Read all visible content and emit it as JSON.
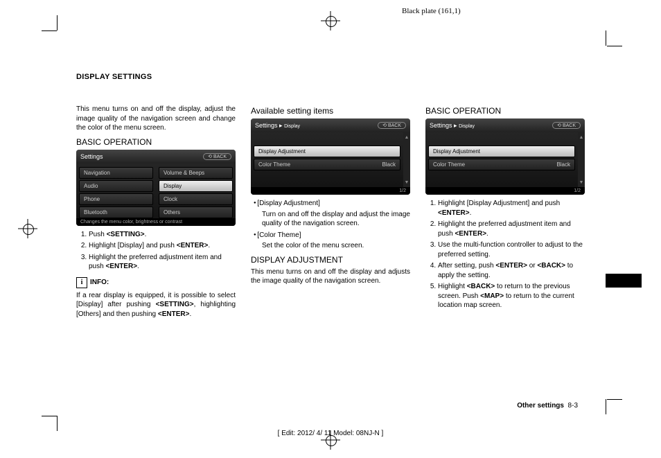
{
  "plate": "Black plate (161,1)",
  "heading": "DISPLAY SETTINGS",
  "col1": {
    "intro": "This menu turns on and off the display, adjust the image quality of the navigation screen and change the color of the menu screen.",
    "h_basic": "BASIC OPERATION",
    "screen": {
      "title": "Settings",
      "back": "BACK",
      "left": [
        "Navigation",
        "Audio",
        "Phone",
        "Bluetooth"
      ],
      "right": [
        "Volume & Beeps",
        "Display",
        "Clock",
        "Others"
      ],
      "footer": "Changes the menu color, brightness or contrast"
    },
    "steps": [
      "Push <SETTING>.",
      "Highlight [Display] and push <ENTER>.",
      "Highlight the preferred adjustment item and push <ENTER>."
    ],
    "info_label": "INFO:",
    "info_text": "If a rear display is equipped, it is possible to select [Display] after pushing <SETTING>, highlighting [Others] and then pushing <ENTER>."
  },
  "col2": {
    "h_avail": "Available setting items",
    "screen": {
      "title": "Settings",
      "crumb": "Display",
      "back": "BACK",
      "rows": [
        {
          "l": "Display Adjustment",
          "r": ""
        },
        {
          "l": "Color Theme",
          "r": "Black"
        }
      ],
      "page": "1/2"
    },
    "bullets": [
      {
        "head": "[Display Adjustment]",
        "body": "Turn on and off the display and adjust the image quality of the navigation screen."
      },
      {
        "head": "[Color Theme]",
        "body": "Set the color of the menu screen."
      }
    ],
    "h_adj": "DISPLAY ADJUSTMENT",
    "adj_text": "This menu turns on and off the display and adjusts the image quality of the navigation screen."
  },
  "col3": {
    "h_basic": "BASIC OPERATION",
    "screen": {
      "title": "Settings",
      "crumb": "Display",
      "back": "BACK",
      "rows": [
        {
          "l": "Display Adjustment",
          "r": ""
        },
        {
          "l": "Color Theme",
          "r": "Black"
        }
      ],
      "page": "1/2"
    },
    "steps": [
      "Highlight [Display Adjustment] and push <ENTER>.",
      "Highlight the preferred adjustment item and push <ENTER>.",
      "Use the multi-function controller to adjust to the preferred setting.",
      "After setting, push <ENTER> or <BACK> to apply the setting.",
      "Highlight <BACK> to return to the previous screen. Push <MAP> to return to the current location map screen."
    ]
  },
  "footer": {
    "section": "Other settings",
    "page": "8-3"
  },
  "edit": "[ Edit: 2012/ 4/ 11   Model: 08NJ-N ]"
}
